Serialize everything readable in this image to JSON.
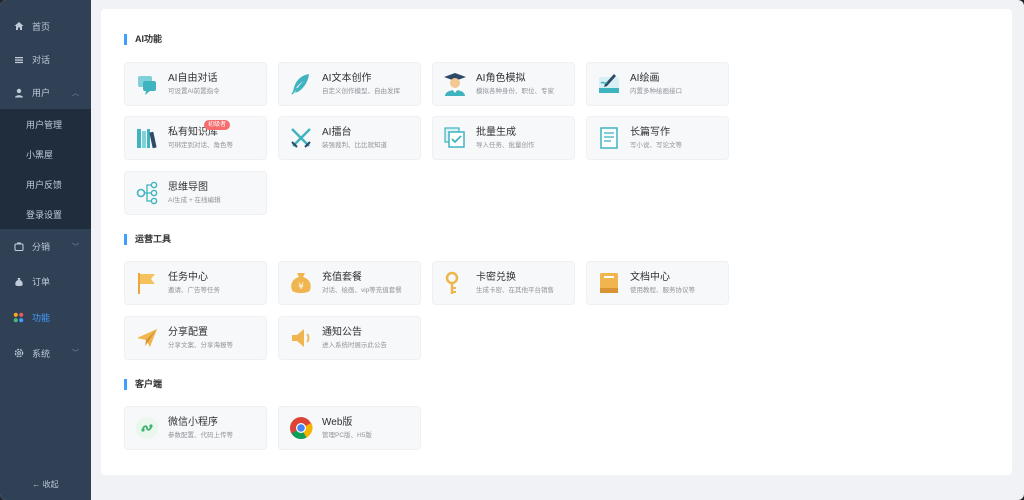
{
  "sidebar": {
    "items": [
      {
        "label": "首页",
        "icon": "home-icon"
      },
      {
        "label": "对话",
        "icon": "list-icon"
      },
      {
        "label": "用户",
        "icon": "user-icon",
        "expanded": true
      },
      {
        "label": "分销",
        "icon": "distribution-icon"
      },
      {
        "label": "订单",
        "icon": "order-bag-icon"
      },
      {
        "label": "功能",
        "icon": "grid-icon",
        "active": true
      },
      {
        "label": "系统",
        "icon": "gear-icon"
      }
    ],
    "user_submenu": [
      "用户管理",
      "小黑屋",
      "用户反馈",
      "登录设置"
    ],
    "collapse_label": "收起",
    "active_color": "#409eff"
  },
  "sections": [
    {
      "title": "AI功能",
      "cards": [
        {
          "name": "AI自由对话",
          "desc": "可设置AI前置指令",
          "icon": "chat-bubble-icon"
        },
        {
          "name": "AI文本创作",
          "desc": "自定义创作模型、自由发挥",
          "icon": "feather-icon"
        },
        {
          "name": "AI角色模拟",
          "desc": "模拟各种身份、职位、专家",
          "icon": "graduate-icon"
        },
        {
          "name": "AI绘画",
          "desc": "内置多种绘画接口",
          "icon": "paint-icon"
        },
        {
          "name": "私有知识库",
          "desc": "可绑定到对话、角色等",
          "icon": "books-icon",
          "badge": "初级者"
        },
        {
          "name": "AI擂台",
          "desc": "装强裁判、比比就知道",
          "icon": "crossed-swords-icon"
        },
        {
          "name": "批量生成",
          "desc": "导入任务、批量创作",
          "icon": "batch-icon"
        },
        {
          "name": "长篇写作",
          "desc": "写小说、写论文等",
          "icon": "document-icon"
        },
        {
          "name": "思维导图",
          "desc": "AI生成 + 在线编辑",
          "icon": "mindmap-icon"
        }
      ]
    },
    {
      "title": "运营工具",
      "cards": [
        {
          "name": "任务中心",
          "desc": "邀请、广告等任务",
          "icon": "flag-icon"
        },
        {
          "name": "充值套餐",
          "desc": "对话、绘画、vip等充值套餐",
          "icon": "money-bag-icon"
        },
        {
          "name": "卡密兑换",
          "desc": "生成卡密、在其他平台销售",
          "icon": "key-icon"
        },
        {
          "name": "文档中心",
          "desc": "使用教程、服务协议等",
          "icon": "book-icon"
        },
        {
          "name": "分享配置",
          "desc": "分享文案、分享海报等",
          "icon": "paper-plane-icon"
        },
        {
          "name": "通知公告",
          "desc": "进入系统时展示此公告",
          "icon": "speaker-icon"
        }
      ]
    },
    {
      "title": "客户端",
      "cards": [
        {
          "name": "微信小程序",
          "desc": "参数配置、代码上传等",
          "icon": "mini-program-icon"
        },
        {
          "name": "Web版",
          "desc": "管理PC版、H5版",
          "icon": "chrome-icon"
        }
      ]
    }
  ]
}
